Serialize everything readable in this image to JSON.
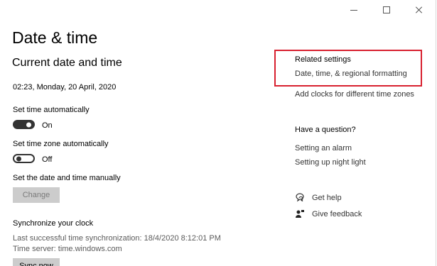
{
  "window": {
    "minimize_icon": "minimize-icon",
    "maximize_icon": "maximize-icon",
    "close_icon": "close-icon"
  },
  "page": {
    "title": "Date & time"
  },
  "current": {
    "section_title": "Current date and time",
    "datetime": "02:23, Monday, 20 April, 2020"
  },
  "set_time_auto": {
    "label": "Set time automatically",
    "state": "On",
    "enabled": true
  },
  "set_timezone_auto": {
    "label": "Set time zone automatically",
    "state": "Off",
    "enabled": false
  },
  "manual": {
    "label": "Set the date and time manually",
    "button_label": "Change"
  },
  "sync": {
    "title": "Synchronize your clock",
    "last_sync": "Last successful time synchronization: 18/4/2020 8:12:01 PM",
    "time_server": "Time server: time.windows.com",
    "button_label": "Sync now"
  },
  "related": {
    "heading": "Related settings",
    "links": [
      "Date, time, & regional formatting",
      "Add clocks for different time zones"
    ]
  },
  "question": {
    "heading": "Have a question?",
    "links": [
      "Setting an alarm",
      "Setting up night light"
    ]
  },
  "help": {
    "get_help": "Get help",
    "give_feedback": "Give feedback"
  },
  "colors": {
    "highlight_border": "#d8202f",
    "toggle_dark": "#333333",
    "button_disabled_bg": "#cccccc"
  }
}
